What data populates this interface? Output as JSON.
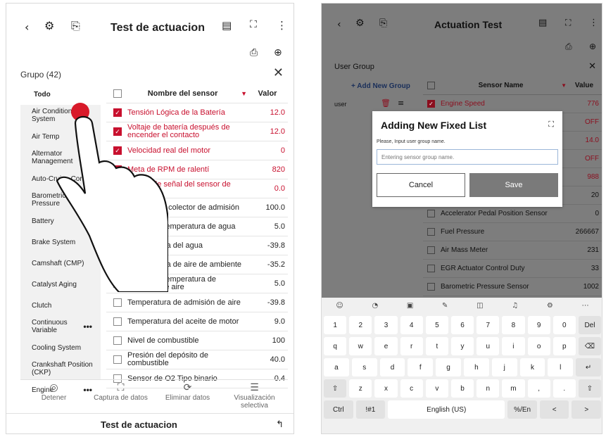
{
  "left": {
    "title": "Test de actuacion",
    "group_label": "Grupo (42)",
    "sidebar": [
      {
        "label": "Todo",
        "active": true,
        "more": false
      },
      {
        "label": "Air Conditioning System",
        "active": false,
        "more": false
      },
      {
        "label": "Air Temp",
        "active": false,
        "more": false
      },
      {
        "label": "Alternator Management",
        "active": false,
        "more": true
      },
      {
        "label": "Auto-Cruise Control",
        "active": false,
        "more": false
      },
      {
        "label": "Barometric Pressure",
        "active": false,
        "more": false
      },
      {
        "label": "Battery",
        "active": false,
        "more": false
      },
      {
        "label": "Brake System",
        "active": false,
        "more": false
      },
      {
        "label": "Camshaft (CMP)",
        "active": false,
        "more": false
      },
      {
        "label": "Catalyst Aging",
        "active": false,
        "more": false
      },
      {
        "label": "Clutch",
        "active": false,
        "more": false
      },
      {
        "label": "Continuous Variable",
        "active": false,
        "more": true
      },
      {
        "label": "Cooling System",
        "active": false,
        "more": false
      },
      {
        "label": "Crankshaft Position (CKP)",
        "active": false,
        "more": false
      },
      {
        "label": "Engine",
        "active": false,
        "more": true
      }
    ],
    "table_header": {
      "name": "Nombre del sensor",
      "value": "Valor"
    },
    "rows": [
      {
        "name": "Tensión Lógica de la Batería",
        "value": "12.0",
        "checked": true
      },
      {
        "name": "Voltaje de batería después de encender el contacto",
        "value": "12.0",
        "checked": true
      },
      {
        "name": "Velocidad real del motor",
        "value": "0",
        "checked": true
      },
      {
        "name": "Meta de RPM de ralentí",
        "value": "820",
        "checked": true
      },
      {
        "name": "Voltaje de señal del sensor de presión",
        "value": "0.0",
        "checked": true
      },
      {
        "name": "Presión del colector de admisión",
        "value": "100.0",
        "checked": false
      },
      {
        "name": "Voltaje de temperatura de agua",
        "value": "5.0",
        "checked": false
      },
      {
        "name": "Temperatura del agua",
        "value": "-39.8",
        "checked": false
      },
      {
        "name": "Temperatura de aire de ambiente",
        "value": "-35.2",
        "checked": false
      },
      {
        "name": "Voltaje de temperatura de admisión de aire",
        "value": "5.0",
        "checked": false
      },
      {
        "name": "Temperatura de admisión de aire",
        "value": "-39.8",
        "checked": false
      },
      {
        "name": "Temperatura del aceite de motor",
        "value": "9.0",
        "checked": false
      },
      {
        "name": "Nivel de combustible",
        "value": "100",
        "checked": false
      },
      {
        "name": "Presión del depósito de combustible",
        "value": "40.0",
        "checked": false
      },
      {
        "name": "Sensor de O2 Tipo binario",
        "value": "0.4",
        "checked": false
      }
    ],
    "actions": [
      {
        "label": "Detener",
        "icon": "stop-icon",
        "glyph": "◎"
      },
      {
        "label": "Captura de datos",
        "icon": "capture-icon",
        "glyph": "⛶"
      },
      {
        "label": "Eliminar datos",
        "icon": "refresh-icon",
        "glyph": "⟳"
      },
      {
        "label": "Visualización selectiva",
        "icon": "selective-view-icon",
        "glyph": "☰"
      }
    ],
    "footer_title": "Test de actuacion"
  },
  "right": {
    "title": "Actuation Test",
    "group_label": "User Group",
    "add_group": "+ Add New Group",
    "group_user": "user",
    "table_header": {
      "name": "Sensor Name",
      "value": "Value"
    },
    "rows": [
      {
        "name": "Engine Speed",
        "value": "776",
        "checked": true
      },
      {
        "name": "",
        "value": "OFF",
        "checked": true
      },
      {
        "name": "",
        "value": "14.0",
        "checked": true
      },
      {
        "name": "",
        "value": "OFF",
        "checked": true
      },
      {
        "name": "",
        "value": "988",
        "checked": true
      },
      {
        "name": "",
        "value": "20",
        "checked": false
      },
      {
        "name": "Accelerator Pedal Position Sensor",
        "value": "0",
        "checked": false
      },
      {
        "name": "Fuel Pressure",
        "value": "266667",
        "checked": false
      },
      {
        "name": "Air Mass Meter",
        "value": "231",
        "checked": false
      },
      {
        "name": "EGR Actuator Control Duty",
        "value": "33",
        "checked": false
      },
      {
        "name": "Barometric Pressure Sensor",
        "value": "1002",
        "checked": false
      },
      {
        "name": "Intake Air Temperature",
        "value": "40",
        "checked": false
      }
    ],
    "dialog": {
      "title": "Adding New Fixed List",
      "hint": "Please, Input user group name.",
      "placeholder": "Entering sensor group name.",
      "cancel": "Cancel",
      "save": "Save"
    },
    "keyboard": {
      "row1": [
        "1",
        "2",
        "3",
        "4",
        "5",
        "6",
        "7",
        "8",
        "9",
        "0",
        "Del"
      ],
      "row2": [
        "q",
        "w",
        "e",
        "r",
        "t",
        "y",
        "u",
        "i",
        "o",
        "p",
        "⌫"
      ],
      "row3": [
        "a",
        "s",
        "d",
        "f",
        "g",
        "h",
        "j",
        "k",
        "l",
        "↵"
      ],
      "row4": [
        "⇧",
        "z",
        "x",
        "c",
        "v",
        "b",
        "n",
        "m",
        ",",
        ".",
        "⇧"
      ],
      "row5": [
        "Ctrl",
        "!#1",
        "English (US)",
        "%/En",
        "<",
        ">"
      ]
    }
  }
}
